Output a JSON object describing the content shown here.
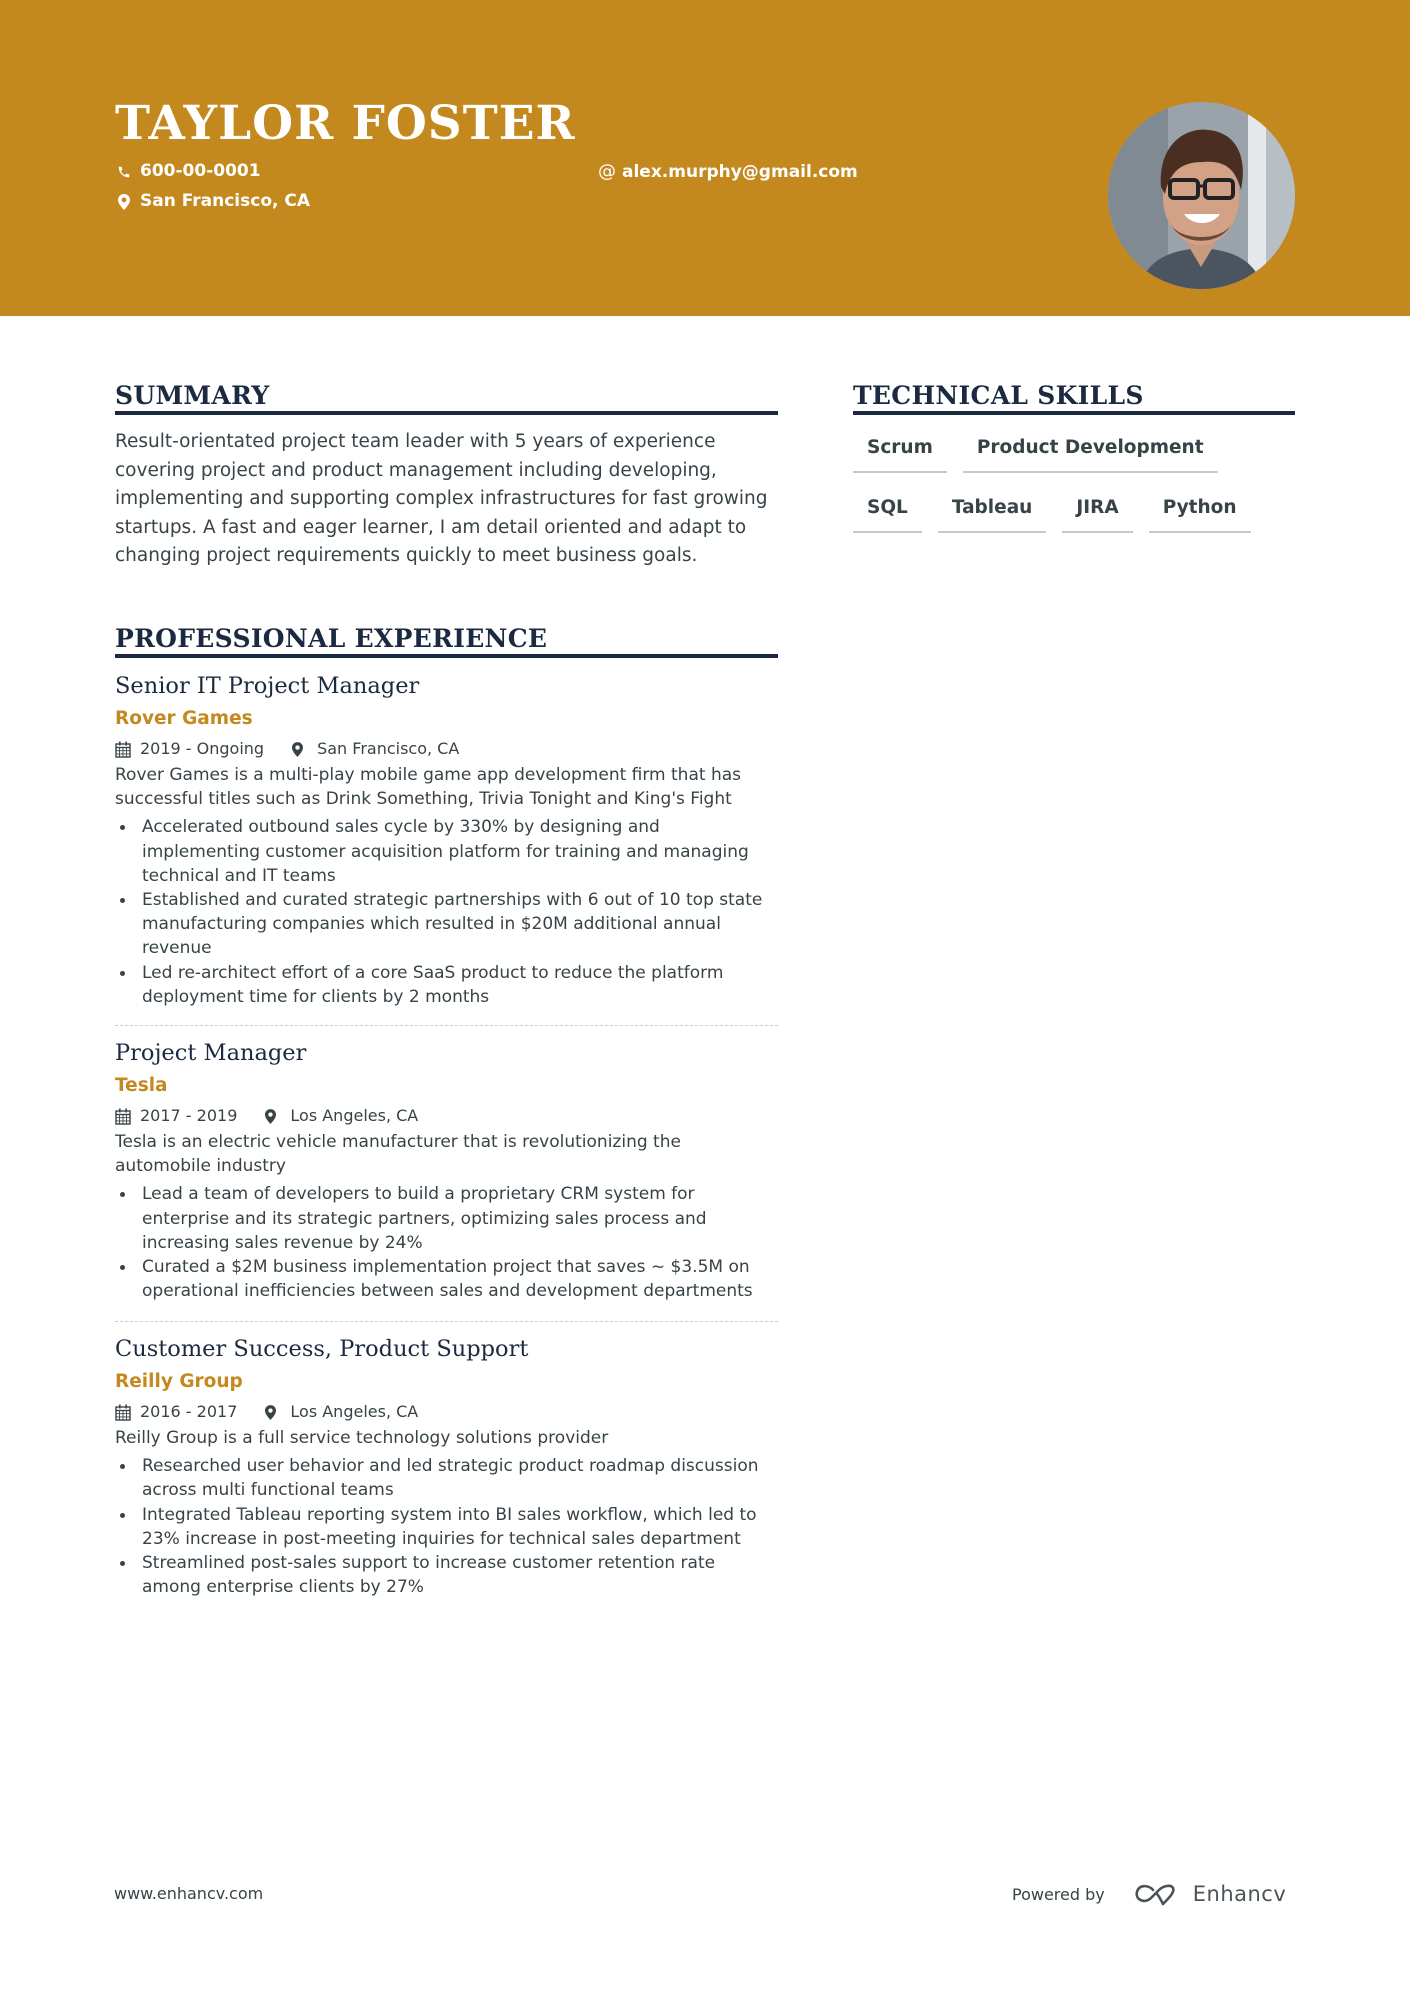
{
  "header": {
    "name": "TAYLOR FOSTER",
    "phone": "600-00-0001",
    "email": "alex.murphy@gmail.com",
    "email_icon": "@",
    "location": "San Francisco, CA",
    "photo_alt": "profile-photo",
    "background_color": "#c4891e"
  },
  "summary": {
    "heading": "SUMMARY",
    "text": "Result-orientated project team leader with 5 years of experience covering project and product management including developing, implementing and supporting complex infrastructures for fast growing startups. A fast and eager learner, I am detail oriented and adapt to changing project requirements quickly to meet business goals."
  },
  "skills": {
    "heading": "TECHNICAL SKILLS",
    "items": [
      "Scrum",
      "Product Development",
      "SQL",
      "Tableau",
      "JIRA",
      "Python"
    ]
  },
  "experience": {
    "heading": "PROFESSIONAL EXPERIENCE",
    "jobs": [
      {
        "title": "Senior IT Project Manager",
        "company": "Rover Games",
        "dates": "2019 - Ongoing",
        "location": "San Francisco, CA",
        "description": "Rover Games is a multi-play mobile game app development firm that has successful titles such as Drink Something, Trivia Tonight and King's Fight",
        "bullets": [
          "Accelerated outbound sales cycle by 330% by designing and implementing customer acquisition platform for training and managing technical and IT teams",
          "Established and curated strategic partnerships with 6 out of 10 top state manufacturing companies which resulted in $20M additional annual revenue",
          "Led re-architect effort of a core SaaS product to reduce the platform deployment time for clients by 2 months"
        ]
      },
      {
        "title": "Project Manager",
        "company": "Tesla",
        "dates": "2017 - 2019",
        "location": "Los Angeles, CA",
        "description": "Tesla is an electric vehicle manufacturer that is revolutionizing the automobile industry",
        "bullets": [
          "Lead a team of developers to build a proprietary CRM system for enterprise and its strategic partners, optimizing sales process and increasing sales revenue by 24%",
          "Curated a $2M business implementation project that saves ~ $3.5M on operational inefficiencies between sales and development departments"
        ]
      },
      {
        "title": "Customer Success, Product Support",
        "company": "Reilly Group",
        "dates": "2016 - 2017",
        "location": "Los Angeles, CA",
        "description": "Reilly Group is a full service technology solutions provider",
        "bullets": [
          "Researched user behavior and led strategic product roadmap discussion across multi functional teams",
          "Integrated Tableau reporting system into BI sales workflow, which led to 23% increase in post-meeting inquiries for technical sales department",
          "Streamlined post-sales support to increase customer retention rate among enterprise clients by 27%"
        ]
      }
    ]
  },
  "footer": {
    "website": "www.enhancv.com",
    "powered_by": "Powered by",
    "brand": "Enhancv"
  },
  "icons": {
    "phone": "phone-icon",
    "location": "map-pin-icon",
    "calendar": "calendar-icon",
    "email": "at-icon",
    "logo": "enhancv-logo-icon"
  },
  "colors": {
    "accent": "#c4891e",
    "heading": "#1b2a40",
    "body_text": "#384347"
  }
}
